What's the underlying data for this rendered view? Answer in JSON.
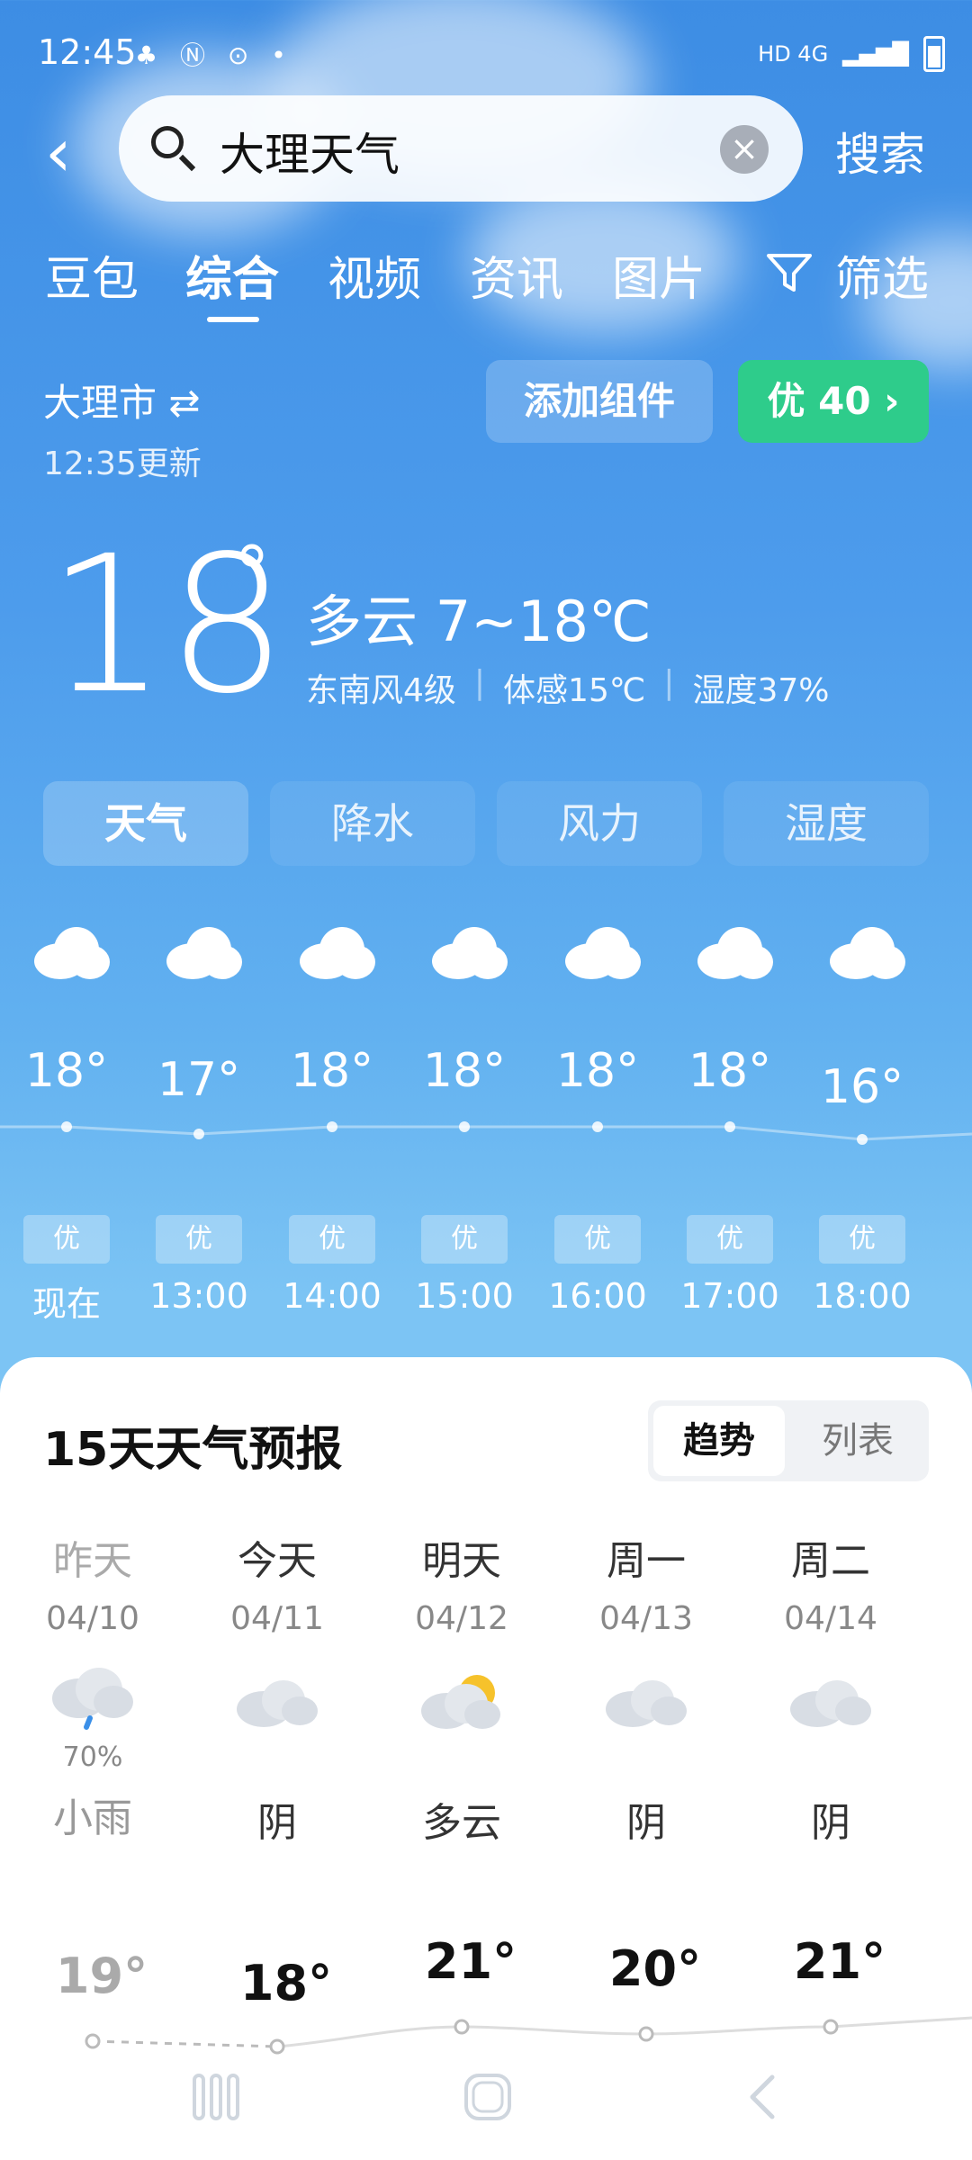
{
  "status_bar": {
    "time": "12:45",
    "right_text": "HD 4G"
  },
  "search": {
    "query": "大理天气",
    "search_label": "搜索"
  },
  "tabs": [
    "豆包",
    "综合",
    "视频",
    "资讯",
    "图片",
    "筛选"
  ],
  "location": {
    "city": "大理市",
    "updated": "12:35更新",
    "add_widget": "添加组件",
    "aqi": "优 40 ›"
  },
  "current": {
    "temp": "18",
    "deg": "°",
    "condition": "多云  7~18℃",
    "wind": "东南风4级",
    "feels": "体感15℃",
    "humidity": "湿度37%"
  },
  "metric_tabs": [
    "天气",
    "降水",
    "风力",
    "湿度"
  ],
  "hourly": [
    {
      "temp": "18°",
      "aqi": "优",
      "time": "现在"
    },
    {
      "temp": "17°",
      "aqi": "优",
      "time": "13:00"
    },
    {
      "temp": "18°",
      "aqi": "优",
      "time": "14:00"
    },
    {
      "temp": "18°",
      "aqi": "优",
      "time": "15:00"
    },
    {
      "temp": "18°",
      "aqi": "优",
      "time": "16:00"
    },
    {
      "temp": "18°",
      "aqi": "优",
      "time": "17:00"
    },
    {
      "temp": "16°",
      "aqi": "优",
      "time": "18:00"
    }
  ],
  "forecast": {
    "title": "15天天气预报",
    "toggle_on": "趋势",
    "toggle_off": "列表",
    "days": [
      {
        "name": "昨天",
        "date": "04/10",
        "rain": "70%",
        "cond": "小雨",
        "high": "19°",
        "icon": "rain-cloud-icon"
      },
      {
        "name": "今天",
        "date": "04/11",
        "rain": "",
        "cond": "阴",
        "high": "18°",
        "icon": "cloud-icon"
      },
      {
        "name": "明天",
        "date": "04/12",
        "rain": "",
        "cond": "多云",
        "high": "21°",
        "icon": "partly-cloudy-icon"
      },
      {
        "name": "周一",
        "date": "04/13",
        "rain": "",
        "cond": "阴",
        "high": "20°",
        "icon": "cloud-icon"
      },
      {
        "name": "周二",
        "date": "04/14",
        "rain": "",
        "cond": "阴",
        "high": "21°",
        "icon": "cloud-icon"
      }
    ]
  },
  "colors": {
    "accent_green": "#2ecc8b",
    "sky_top": "#3d8de4",
    "sky_bottom": "#7cc4f4"
  }
}
